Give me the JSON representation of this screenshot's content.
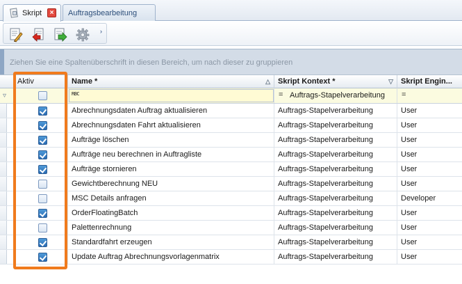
{
  "tabs": [
    {
      "label": "Skript",
      "active": true,
      "closable": true
    },
    {
      "label": "Auftragsbearbeitung",
      "active": false
    }
  ],
  "toolbar": {
    "buttons": [
      "edit-script-icon",
      "revert-icon",
      "run-script-icon",
      "settings-gear-icon"
    ],
    "more_glyph": "›"
  },
  "grid": {
    "group_panel_text": "Ziehen Sie eine Spaltenüberschrift in diesen Bereich, um nach dieser zu gruppieren",
    "columns": [
      {
        "key": "aktiv",
        "label": "Aktiv",
        "bold": false
      },
      {
        "key": "name",
        "label": "Name *",
        "bold": true,
        "sort_glyph": "△"
      },
      {
        "key": "kontext",
        "label": "Skript Kontext *",
        "bold": true,
        "sort_glyph": "▽"
      },
      {
        "key": "engine",
        "label": "Skript Engin...",
        "bold": true
      }
    ],
    "filter": {
      "name_operator": "RBC",
      "kontext_operator": "=",
      "kontext_value": "Auftrags-Stapelverarbeitung",
      "engine_operator": "="
    },
    "rows": [
      {
        "aktiv": true,
        "name": "Abrechnungsdaten Auftrag aktualisieren",
        "kontext": "Auftrags-Stapelverarbeitung",
        "engine": "User"
      },
      {
        "aktiv": true,
        "name": "Abrechnungsdaten Fahrt aktualisieren",
        "kontext": "Auftrags-Stapelverarbeitung",
        "engine": "User"
      },
      {
        "aktiv": true,
        "name": "Aufträge löschen",
        "kontext": "Auftrags-Stapelverarbeitung",
        "engine": "User"
      },
      {
        "aktiv": true,
        "name": "Aufträge neu berechnen in Auftragliste",
        "kontext": "Auftrags-Stapelverarbeitung",
        "engine": "User"
      },
      {
        "aktiv": true,
        "name": "Aufträge stornieren",
        "kontext": "Auftrags-Stapelverarbeitung",
        "engine": "User"
      },
      {
        "aktiv": false,
        "name": "Gewichtberechnung NEU",
        "kontext": "Auftrags-Stapelverarbeitung",
        "engine": "User"
      },
      {
        "aktiv": false,
        "name": "MSC Details anfragen",
        "kontext": "Auftrags-Stapelverarbeitung",
        "engine": "Developer"
      },
      {
        "aktiv": true,
        "name": "OrderFloatingBatch",
        "kontext": "Auftrags-Stapelverarbeitung",
        "engine": "User"
      },
      {
        "aktiv": false,
        "name": "Palettenrechnung",
        "kontext": "Auftrags-Stapelverarbeitung",
        "engine": "User"
      },
      {
        "aktiv": true,
        "name": "Standardfahrt erzeugen",
        "kontext": "Auftrags-Stapelverarbeitung",
        "engine": "User"
      },
      {
        "aktiv": true,
        "name": "Update Auftrag Abrechnungsvorlagenmatrix",
        "kontext": "Auftrags-Stapelverarbeitung",
        "engine": "User"
      }
    ]
  },
  "colors": {
    "highlight_border": "#f07b1d",
    "checkbox_checked": "#2a6cb3",
    "filter_row_bg": "#fbfbe0",
    "close_button": "#e34a3f"
  }
}
